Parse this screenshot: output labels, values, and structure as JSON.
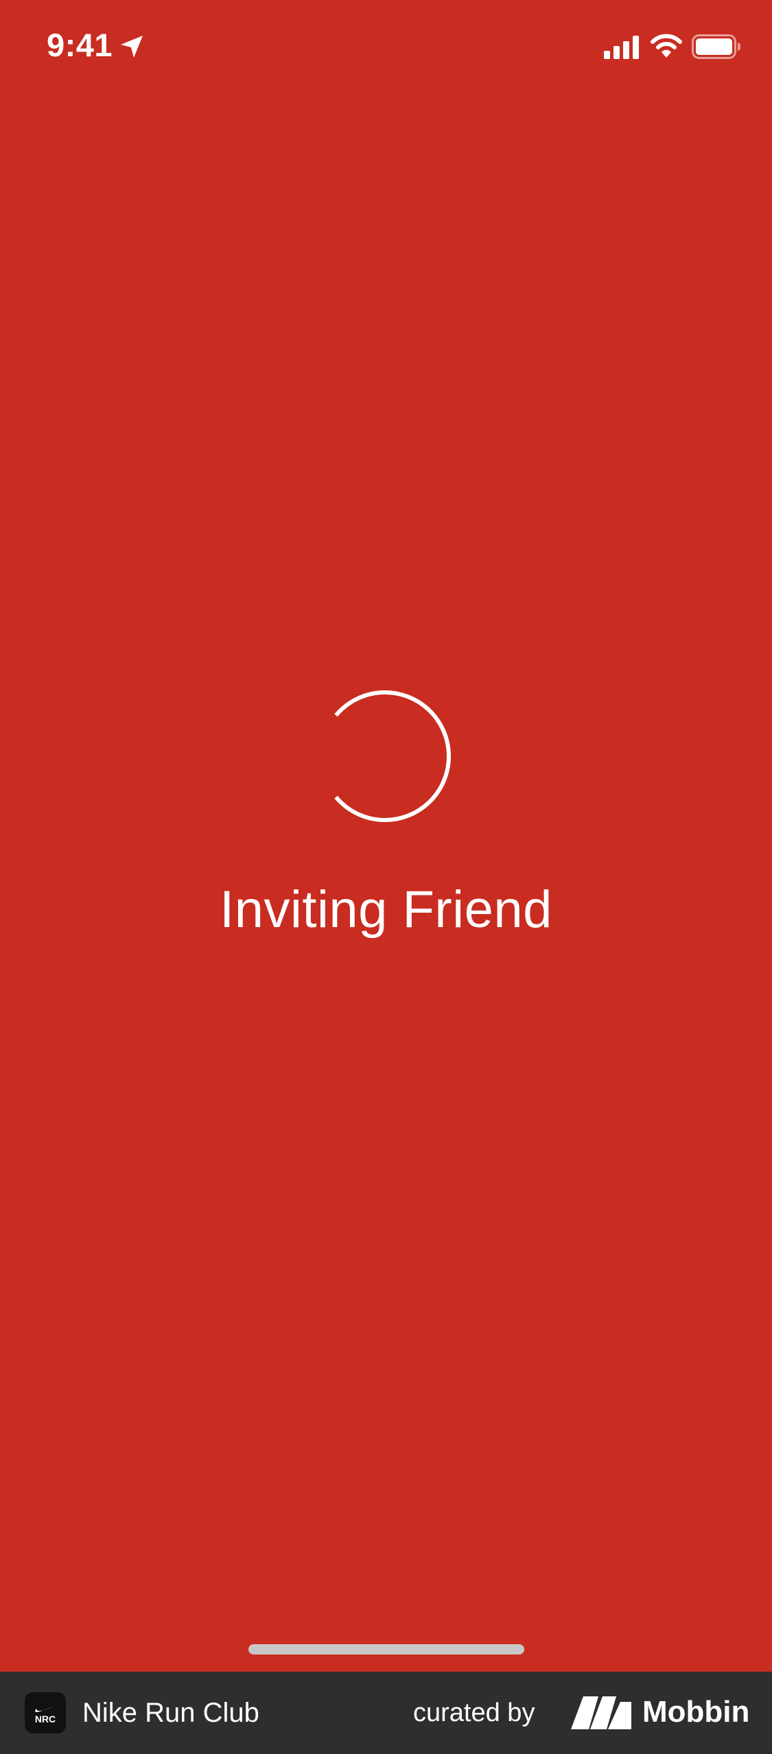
{
  "status_bar": {
    "time": "9:41",
    "icons": [
      "location-arrow-icon",
      "cellular-signal-icon",
      "wifi-icon",
      "battery-icon"
    ]
  },
  "loader": {
    "title": "Inviting Friend",
    "icon": "spinner-icon"
  },
  "footer": {
    "app_icon_label": "NRC",
    "app_name": "Nike Run Club",
    "curated_label": "curated by",
    "brand_name": "Mobbin"
  },
  "colors": {
    "background": "#C92C20",
    "foreground": "#FFFFFF",
    "footer_background": "#2E2E2E",
    "home_indicator": "#C8C8C8"
  }
}
